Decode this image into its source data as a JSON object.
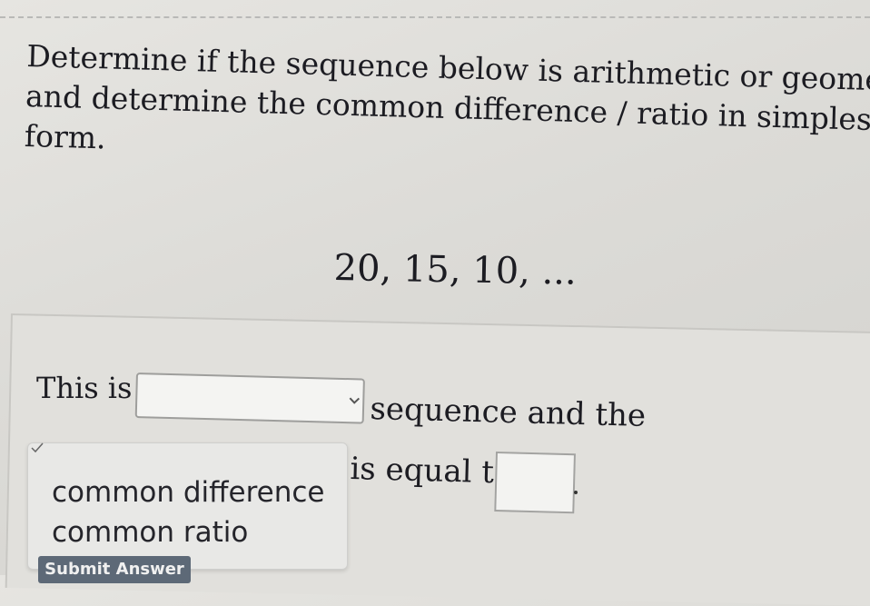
{
  "question": {
    "line1": "Determine if the sequence below is arithmetic or geometric",
    "line2": "and determine the common difference / ratio in simplest",
    "line3": "form."
  },
  "sequence": "20, 15, 10, ...",
  "answer": {
    "prefix": "This is",
    "sequence_type_selected": "",
    "middle": "sequence and the",
    "suffix": "is equal to",
    "value": ""
  },
  "dropdown": {
    "options": [
      "common difference",
      "common ratio"
    ]
  },
  "submit_label": "Submit Answer",
  "icons": {
    "select": "chevron-down-icon",
    "checked": "check-icon",
    "pointer": "cursor-icon"
  }
}
